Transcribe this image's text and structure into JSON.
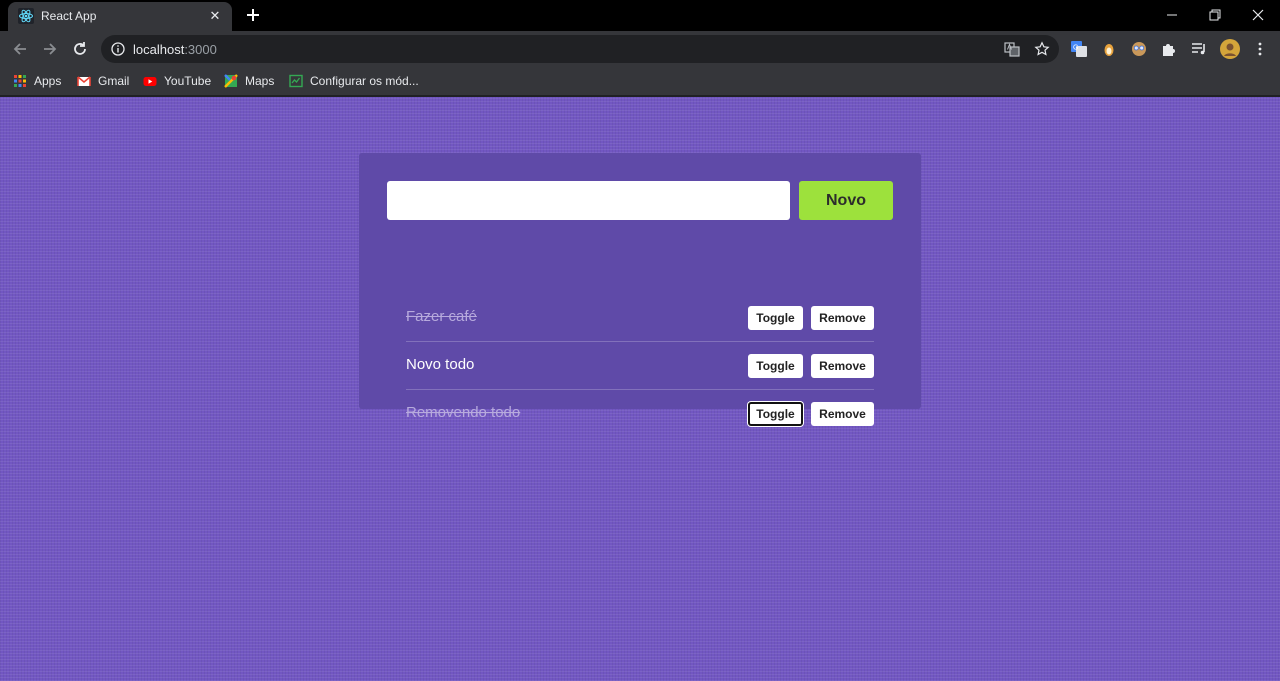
{
  "browser": {
    "tab": {
      "title": "React App",
      "close_glyph": "✕",
      "favicon": "react-icon"
    },
    "url": {
      "host": "localhost",
      "port": ":3000"
    },
    "bookmarks": [
      {
        "label": "Apps",
        "icon": "apps-grid-icon"
      },
      {
        "label": "Gmail",
        "icon": "gmail-icon"
      },
      {
        "label": "YouTube",
        "icon": "youtube-icon"
      },
      {
        "label": "Maps",
        "icon": "maps-icon"
      },
      {
        "label": "Configurar os mód...",
        "icon": "sheet-icon"
      }
    ],
    "colors": {
      "chrome_dark": "#35363a",
      "tabstrip": "#000000"
    }
  },
  "app": {
    "input": {
      "value": "",
      "placeholder": ""
    },
    "add_button": "Novo",
    "todos": [
      {
        "text": "Fazer café",
        "done": true
      },
      {
        "text": "Novo todo",
        "done": false
      },
      {
        "text": "Removendo todo",
        "done": true
      }
    ],
    "toggle_label": "Toggle",
    "remove_label": "Remove",
    "colors": {
      "page_bg": "#7257c2",
      "card_bg": "#5f4aa8",
      "accent": "#9de13c"
    }
  }
}
